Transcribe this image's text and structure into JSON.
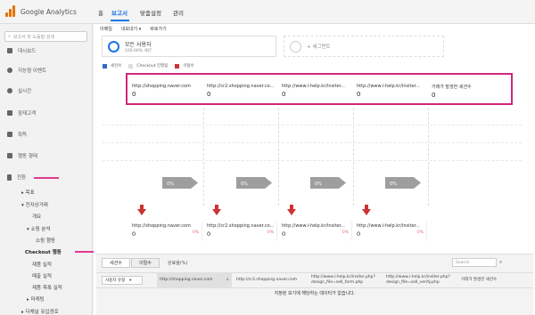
{
  "app": {
    "name": "Google Analytics"
  },
  "topnav": {
    "home": "홈",
    "report": "보고서",
    "custom": "맞춤설정",
    "admin": "관리"
  },
  "sidebar": {
    "search_placeholder": "보고서 및 도움말 검색",
    "items": [
      {
        "label": "대시보드",
        "icon": "dashboard-icon"
      },
      {
        "label": "지능형 이벤트",
        "icon": "lightbulb-icon"
      },
      {
        "label": "실시간",
        "icon": "clock-icon"
      },
      {
        "label": "잠재고객",
        "icon": "people-icon"
      },
      {
        "label": "획득",
        "icon": "acquisition-icon"
      },
      {
        "label": "행동 형태",
        "icon": "behavior-icon"
      },
      {
        "label": "전환",
        "icon": "flag-icon"
      }
    ],
    "sub": [
      "▸ 목표",
      "▾ 전자상거래",
      "개요",
      "▾ 쇼핑 분석",
      "쇼핑 행동",
      "Checkout 행동",
      "제품 실적",
      "매출 실적",
      "제품 목록 실적",
      "▸ 마케팅",
      "▸ 다채널 유입경로"
    ]
  },
  "toolbar": {
    "email": "이메일",
    "export": "내보내기 ▾",
    "shortcut": "바로가기"
  },
  "segments": [
    {
      "title": "모든 사용자",
      "sub": "100.00% 세션"
    },
    {
      "title": "+ 세그먼트",
      "sub": ""
    }
  ],
  "legend": [
    "세션수",
    "Checkout 진행됨",
    "이탈수"
  ],
  "legend_colors": [
    "#3366cc",
    "#dddddd",
    "#cc3333"
  ],
  "funnel_top": [
    {
      "label": "http://shopping.naver.com",
      "value": "0"
    },
    {
      "label": "http://cr2.shopping.naver.co...",
      "value": "0"
    },
    {
      "label": "http://www.i-help.kr/insiter...",
      "value": "0"
    },
    {
      "label": "http://www.i-help.kr/insiter...",
      "value": "0"
    },
    {
      "label": "거래가 발생한 세션수",
      "value": "0"
    }
  ],
  "funnel_pct": [
    "0%",
    "0%",
    "0%",
    "0%"
  ],
  "funnel_bottom": [
    {
      "label": "http://shopping.naver.com",
      "value": "0",
      "pct": "0%"
    },
    {
      "label": "http://cr2.shopping.naver.co...",
      "value": "0",
      "pct": "0%"
    },
    {
      "label": "http://www.i-help.kr/insiter...",
      "value": "0",
      "pct": "0%"
    },
    {
      "label": "http://www.i-help.kr/insiter...",
      "value": "0",
      "pct": "0%"
    }
  ],
  "table": {
    "tabs": [
      "세션수",
      "이탈수",
      "완료율(%)"
    ],
    "search_placeholder": "Search",
    "dimension_button": "사용자 유형",
    "columns": [
      "http://shopping.naver.com",
      "http://cr2.shopping.naver.com",
      "http://www.i-help.kr/insiter.php?\ndesign_file=sell_form.php",
      "http://www.i-help.kr/insiter.php?\ndesign_file=sell_verify.php",
      "거래가 발생한 세션수"
    ],
    "empty_message": "지정된 보기에 해당하는 데이터가 없습니다."
  }
}
